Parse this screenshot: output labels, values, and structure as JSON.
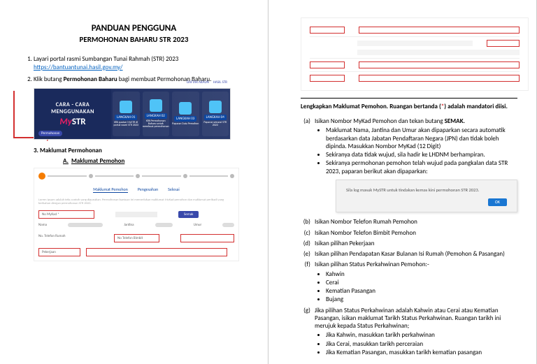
{
  "page1": {
    "title1": "PANDUAN PENGGUNA",
    "title2": "PERMOHONAN BAHARU STR 2023",
    "steps": {
      "s1": "Layari portal rasmi Sumbangan Tunai Rahmah (STR) 2023",
      "s1_link": "https://bantuantunai.hasil.gov.my/",
      "s2_pre": "Klik butang ",
      "s2_bold": "Permohonan Baharu",
      "s2_post": " bagi membuat Permohonan Baharu."
    },
    "banner": {
      "cara": "CARA - CARA",
      "meng": "MENGGUNAKAN",
      "my": "My",
      "str": "STR",
      "st_labels": [
        "LANGKAH 01",
        "LANGKAH 02",
        "LANGKAH 03",
        "LANGKAH 04"
      ],
      "st_text": [
        "Klik pautan MySTR di portal rasmi STR 2023",
        "Klik Permohonan Baharu untuk membuat permohonan",
        "Paparan Data Pemohon",
        "Paparan senarai STR 2023"
      ],
      "top1": "DAFTAR AKAUN",
      "top2": "HASIL STR",
      "btn_new": "Permohonan"
    },
    "h3": "3.   Maklumat Permohonan",
    "subA_label": "A.",
    "subA_text": "Maklumat Pemohon",
    "form": {
      "tab1": "Maklumat Pemohon",
      "tab2": "Pengesahan",
      "tab3": "Selesai",
      "mykad": "No MyKad *",
      "semak": "Semak",
      "col1": "Nama",
      "col2": "Jantina",
      "col3": "Umur",
      "tel": "No. Telefon Rumah",
      "telb_lbl": "No Telefon Bimbit",
      "telb": "No Telefon Bimbit",
      "pek": "Pekerjaan"
    }
  },
  "page2": {
    "instr_pre": "Lengkapkan Maklumat Pemohon. Ruangan bertanda (",
    "instr_star": "*",
    "instr_post": ") adalah mandatori diisi.",
    "a": {
      "line1_pre": "Isikan Nombor MyKad Pemohon dan tekan butang ",
      "line1_bold": "SEMAK.",
      "b1": "Maklumat Nama, Jantina dan Umur akan dipaparkan secara automatik berdasarkan data Jabatan Pendaftaran Negara (JPN) dan tidak boleh dipinda. Masukkan Nombor MyKad (12 Digit)",
      "b2": "Sekiranya data tidak wujud, sila hadir ke LHDNM berhampiran.",
      "b3": "Sekiranya permohonan pemohon telah wujud pada pangkalan data STR 2023, paparan berikut akan dipaparkan:"
    },
    "dialog_text": "Sila log masuk MySTR untuk tindakan kemas kini permohonan STR 2023.",
    "dialog_ok": "OK",
    "b_text": "Isikan Nombor Telefon Rumah Pemohon",
    "c_text": "Isikan Nombor Telefon Bimbit Pemohon",
    "d_text": "Isikan pilihan Pekerjaan",
    "e_text": "Isikan pilihan Pendapatan Kasar Bulanan Isi Rumah (Pemohon & Pasangan)",
    "f_text": "Isikan pilihan Status Perkahwinan Pemohon:-",
    "f_opts": [
      "Kahwin",
      "Cerai",
      "Kematian Pasangan",
      "Bujang"
    ],
    "g_text": "Jika pilihan Status Perkahwinan adalah Kahwin atau Cerai atau Kematian Pasangan, isikan maklumat Tarikh Status Perkahwinan. Ruangan tarikh ini merujuk kepada Status Perkahwinan;",
    "g_opts": [
      "Jika Kahwin, masukkan tarikh perkahwinan",
      "Jika Cerai, masukkan tarikh perceraian",
      "Jika Kematian Pasangan, masukkan tarikh kematian pasangan"
    ]
  }
}
